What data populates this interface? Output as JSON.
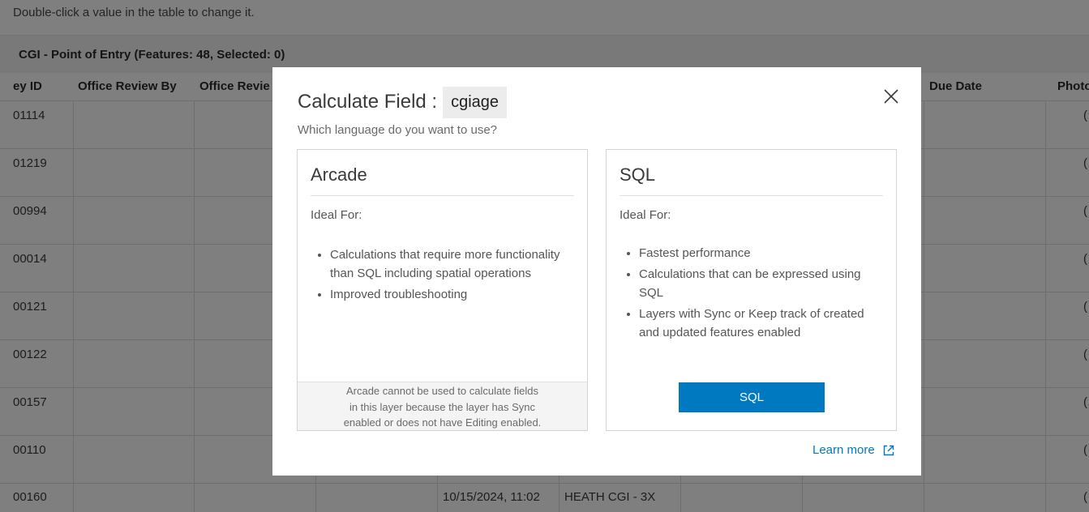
{
  "page": {
    "hint": "Double-click a value in the table to change it."
  },
  "table": {
    "title": "CGI - Point of Entry (Features: 48, Selected: 0)",
    "columns": [
      "ey ID",
      "Office Review By",
      "Office Revie",
      "Due Date",
      "Photo"
    ],
    "rows": [
      {
        "id": "01114",
        "photo": "("
      },
      {
        "id": "01219",
        "photo": "("
      },
      {
        "id": "00994",
        "photo": "("
      },
      {
        "id": "00014",
        "photo": "("
      },
      {
        "id": "00121",
        "photo": "("
      },
      {
        "id": "00122",
        "photo": "("
      },
      {
        "id": "00157",
        "photo": "("
      },
      {
        "id": "00110",
        "photo": "("
      },
      {
        "id": "00160",
        "photo": "(",
        "date": "10/15/2024, 11:02",
        "name": "HEATH CGI - 3X"
      }
    ]
  },
  "modal": {
    "title": "Calculate Field :",
    "field_name": "cgiage",
    "subtitle": "Which language do you want to use?",
    "close_icon": "close-icon",
    "arcade": {
      "title": "Arcade",
      "ideal_for": "Ideal For:",
      "items": [
        "Calculations that require more functionality than SQL including spatial operations",
        "Improved troubleshooting"
      ],
      "disabled_note_lines": [
        "Arcade cannot be used to calculate fields",
        "in this layer because the layer has Sync",
        "enabled or does not have Editing enabled."
      ]
    },
    "sql": {
      "title": "SQL",
      "ideal_for": "Ideal For:",
      "items": [
        "Fastest performance",
        "Calculations that can be expressed using SQL",
        "Layers with Sync or Keep track of created and updated features enabled"
      ],
      "button_label": "SQL"
    },
    "learn_more": "Learn more",
    "learn_more_icon": "external-link-icon",
    "accent_color": "#0079c1"
  }
}
